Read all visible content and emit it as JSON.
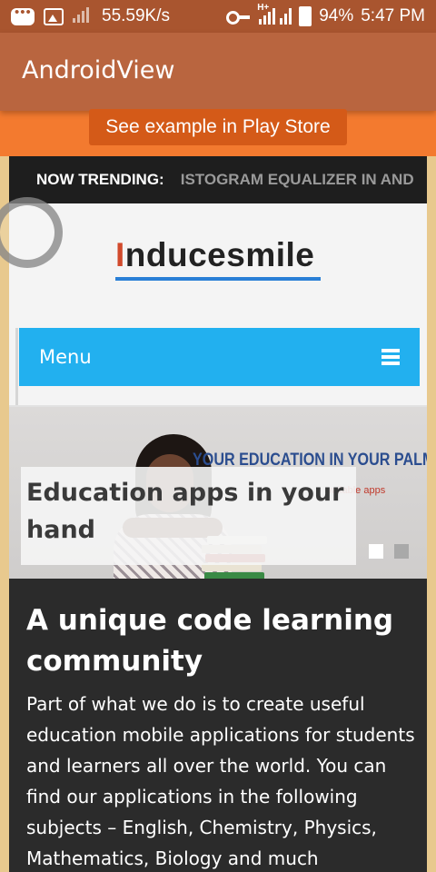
{
  "status_bar": {
    "speed": "55.59K/s",
    "network_type": "H+",
    "battery": "94%",
    "time": "5:47 PM",
    "icons": [
      "chat-icon",
      "image-icon",
      "no-signal-icon",
      "key-icon",
      "signal-icon",
      "battery-charging-icon"
    ]
  },
  "app_bar": {
    "title": "AndroidView"
  },
  "play_store_button": {
    "label": "See example in Play Store"
  },
  "trending": {
    "label": "NOW TRENDING:",
    "text": "ISTOGRAM EQUALIZER IN AND"
  },
  "logo": {
    "first_letter": "I",
    "rest": "nducesmile"
  },
  "menu": {
    "label": "Menu",
    "icon": "hamburger-icon"
  },
  "hero": {
    "tagline": "YOUR EDUCATION IN YOUR PALM",
    "subtext": "vailable apps",
    "caption": "Education apps in your hand",
    "slides": {
      "count": 2,
      "active_index": 0
    }
  },
  "article": {
    "heading": "A unique code learning community",
    "body": "Part of what we do is to create useful education mobile applications for students and learners all over the world. You can find our applications in the following subjects – English, Chemistry, Physics, Mathematics, Biology and much"
  },
  "colors": {
    "status_bar": "#a9552f",
    "app_bar": "#b9653f",
    "accent_orange": "#f37a2f",
    "button": "#d45a18",
    "menu_blue": "#22b0ef",
    "dark_section": "#2b2b2b"
  }
}
